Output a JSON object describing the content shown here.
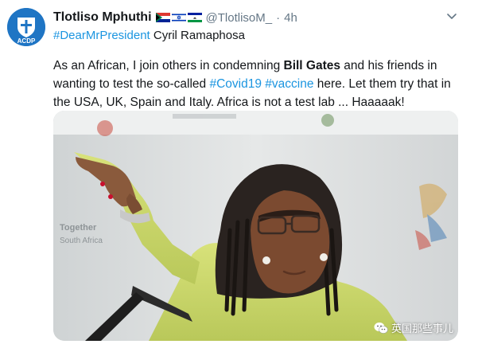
{
  "tweet": {
    "avatar": {
      "icon": "acdp-logo",
      "label": "ACDP"
    },
    "author": {
      "display_name": "Tlotliso Mphuthi",
      "flags": [
        "south-africa-flag-icon",
        "israel-flag-icon",
        "lesotho-flag-icon"
      ],
      "handle": "@TlotlisoM_",
      "separator": "·",
      "timestamp": "4h"
    },
    "reply_line": {
      "hashtag": "#DearMrPresident",
      "mention": "Cyril Ramaphosa"
    },
    "text": {
      "part1": "As an African, I join others in condemning ",
      "bold": "Bill Gates",
      "part2": " and his friends in wanting to test the so-called ",
      "hashtag1": "#Covid19",
      "space": " ",
      "hashtag2": "#vaccine",
      "part3": " here. Let them try that in the USA, UK, Spain and Italy. Africa is not a test lab ... Haaaaak!"
    },
    "media": {
      "type": "photo",
      "backdrop_text": [
        "Together",
        "South Africa"
      ]
    }
  },
  "watermark": {
    "icon": "wechat-icon",
    "text": "英国那些事儿"
  },
  "colors": {
    "link": "#1b95e0",
    "text": "#14171a",
    "secondary": "#657786",
    "avatar_bg": "#1f75c4"
  }
}
